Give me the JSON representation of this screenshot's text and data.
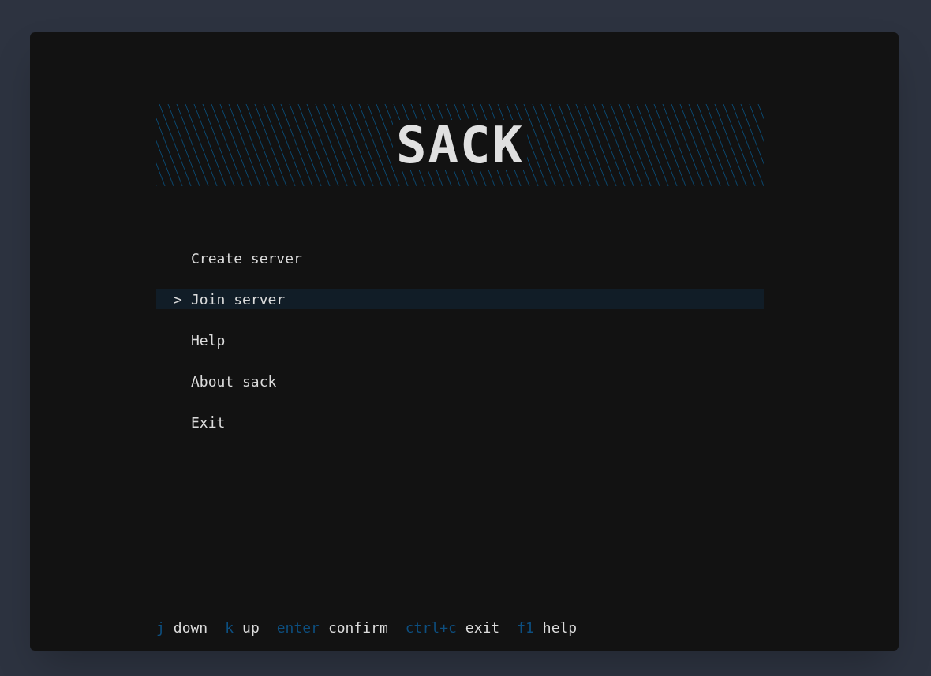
{
  "logo": {
    "text": "SACK"
  },
  "menu": {
    "cursor": ">",
    "items": [
      {
        "label": "Create server",
        "selected": false
      },
      {
        "label": "Join server",
        "selected": true
      },
      {
        "label": "Help",
        "selected": false
      },
      {
        "label": "About sack",
        "selected": false
      },
      {
        "label": "Exit",
        "selected": false
      }
    ]
  },
  "help_bar": [
    {
      "key": "j",
      "action": "down"
    },
    {
      "key": "k",
      "action": "up"
    },
    {
      "key": "enter",
      "action": "confirm"
    },
    {
      "key": "ctrl+c",
      "action": "exit"
    },
    {
      "key": "f1",
      "action": "help"
    }
  ]
}
